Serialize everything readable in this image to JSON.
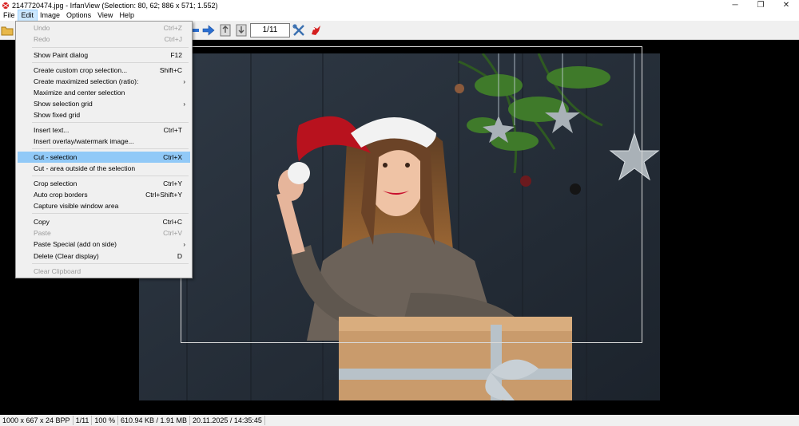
{
  "window": {
    "title": "2147720474.jpg - IrfanView (Selection: 80, 62; 886 x 571; 1.552)",
    "minimize": "─",
    "maximize": "❐",
    "close": "✕"
  },
  "menubar": {
    "items": [
      "File",
      "Edit",
      "Image",
      "Options",
      "View",
      "Help"
    ]
  },
  "toolbar": {
    "page_indicator": "1/11",
    "icons": [
      "open-folder-icon",
      "next-arrow-icon",
      "copy-icon",
      "paste-icon",
      "tools-icon",
      "irfanview-logo-icon"
    ]
  },
  "edit_menu": {
    "items": [
      {
        "label": "Undo",
        "shortcut": "Ctrl+Z",
        "disabled": true
      },
      {
        "label": "Redo",
        "shortcut": "Ctrl+J",
        "disabled": true
      },
      {
        "label": "Show Paint dialog",
        "shortcut": "F12"
      },
      {
        "label": "Create custom crop selection...",
        "shortcut": "Shift+C"
      },
      {
        "label": "Create maximized selection (ratio):",
        "submenu": true
      },
      {
        "label": "Maximize and center selection"
      },
      {
        "label": "Show selection grid",
        "submenu": true
      },
      {
        "label": "Show fixed grid"
      },
      {
        "label": "Insert text...",
        "shortcut": "Ctrl+T"
      },
      {
        "label": "Insert overlay/watermark image..."
      },
      {
        "label": "Cut - selection",
        "shortcut": "Ctrl+X",
        "highlighted": true
      },
      {
        "label": "Cut - area outside of the selection"
      },
      {
        "label": "Crop selection",
        "shortcut": "Ctrl+Y"
      },
      {
        "label": "Auto crop borders",
        "shortcut": "Ctrl+Shift+Y"
      },
      {
        "label": "Capture visible window area"
      },
      {
        "label": "Copy",
        "shortcut": "Ctrl+C"
      },
      {
        "label": "Paste",
        "shortcut": "Ctrl+V",
        "disabled": true
      },
      {
        "label": "Paste Special (add on side)",
        "submenu": true
      },
      {
        "label": "Delete (Clear display)",
        "shortcut": "D"
      },
      {
        "label": "Clear Clipboard",
        "disabled": true
      }
    ]
  },
  "statusbar": {
    "dimensions": "1000 x 667 x 24 BPP",
    "page": "1/11",
    "zoom": "100 %",
    "size": "610.94 KB / 1.91 MB",
    "datetime": "20.11.2025 / 14:35:45"
  },
  "colors": {
    "menu_highlight": "#91c9f7",
    "active_menu": "#cce8ff",
    "background": "#000000"
  }
}
